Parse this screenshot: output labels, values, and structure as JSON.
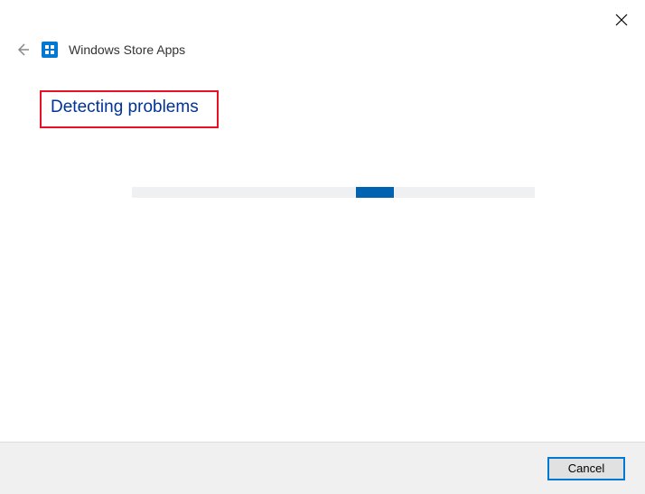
{
  "header": {
    "title": "Windows Store Apps"
  },
  "main": {
    "status_heading": "Detecting problems"
  },
  "footer": {
    "cancel_label": "Cancel"
  },
  "colors": {
    "accent": "#0078d4",
    "heading": "#003399",
    "highlight_border": "#e81123"
  }
}
